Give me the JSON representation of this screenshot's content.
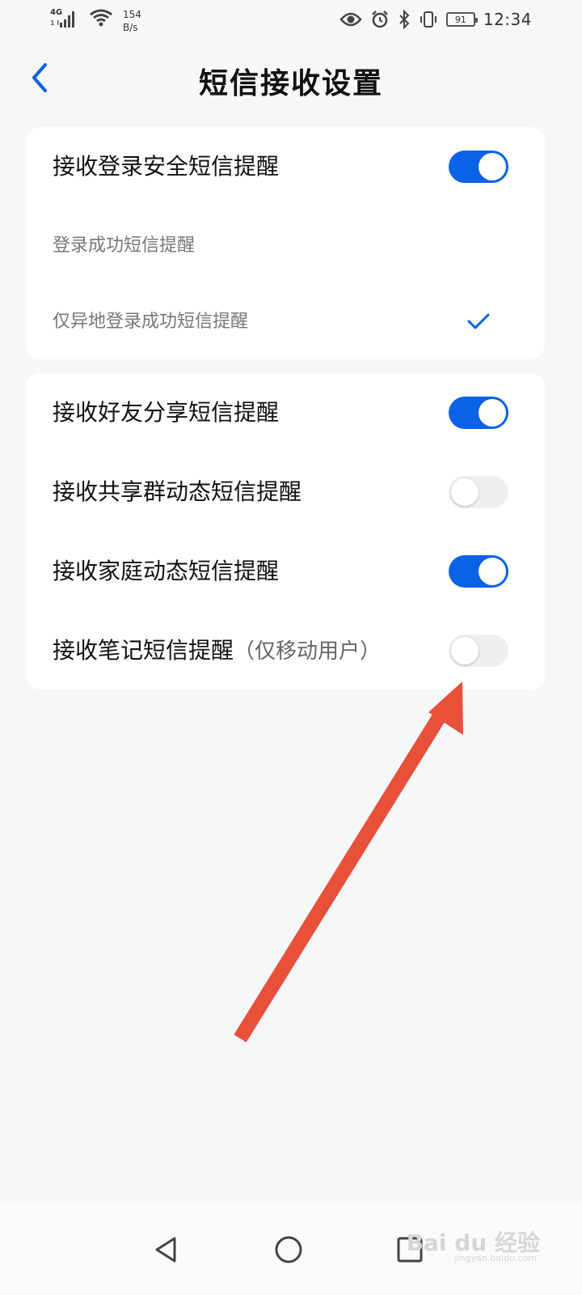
{
  "status_bar": {
    "network": "4G",
    "network_sub": "1 l",
    "speed_value": "154",
    "speed_unit": "B/s",
    "battery": "91",
    "time": "12:34"
  },
  "header": {
    "title": "短信接收设置",
    "back_icon": "chevron-left-icon"
  },
  "section1": {
    "main_toggle": {
      "label": "接收登录安全短信提醒",
      "on": true
    },
    "options": [
      {
        "label": "登录成功短信提醒",
        "checked": false
      },
      {
        "label": "仅异地登录成功短信提醒",
        "checked": true
      }
    ]
  },
  "section2": {
    "items": [
      {
        "label": "接收好友分享短信提醒",
        "sub": "",
        "on": true
      },
      {
        "label": "接收共享群动态短信提醒",
        "sub": "",
        "on": false
      },
      {
        "label": "接收家庭动态短信提醒",
        "sub": "",
        "on": true
      },
      {
        "label": "接收笔记短信提醒",
        "sub": "（仅移动用户）",
        "on": false
      }
    ]
  },
  "colors": {
    "accent": "#0a62e6",
    "annotation_arrow": "#e8503a",
    "background": "#f6f7f9"
  },
  "watermark": {
    "text": "Bai du 经验",
    "sub": "jingyan.baidu.com"
  }
}
